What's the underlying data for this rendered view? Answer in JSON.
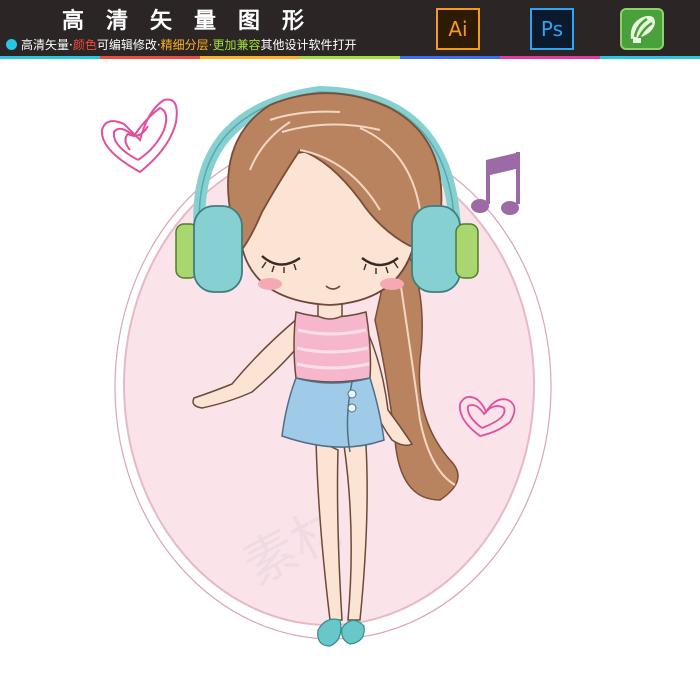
{
  "banner": {
    "title": "高清矢量图形",
    "subtitle_segments": [
      {
        "text": "高清矢量·",
        "color": "white"
      },
      {
        "text": "颜色",
        "color": "red"
      },
      {
        "text": "可编辑修改·",
        "color": "white"
      },
      {
        "text": "精细分层·",
        "color": "orange"
      },
      {
        "text": "更加兼容",
        "color": "green"
      },
      {
        "text": "其他设计软件打开",
        "color": "white"
      }
    ],
    "icons": {
      "ai": "Ai",
      "ps": "Ps",
      "cdr": "corel-draw-icon"
    },
    "strip_colors": [
      "#27c6e3",
      "#f04a3a",
      "#ffb01f",
      "#9ee03b",
      "#3b6ef0",
      "#e03b9e",
      "#27c6e3"
    ]
  },
  "colors": {
    "banner_bg": "#2b2526",
    "oval": "#fbe3ea",
    "hair": "#b98360",
    "headphones": "#86d0d2",
    "top": "#f6b7cc",
    "skirt": "#9fcbe8",
    "note": "#9d6aa8",
    "hearts": "#e0509c"
  },
  "watermark": "素材",
  "illustration": "girl-with-headphones"
}
